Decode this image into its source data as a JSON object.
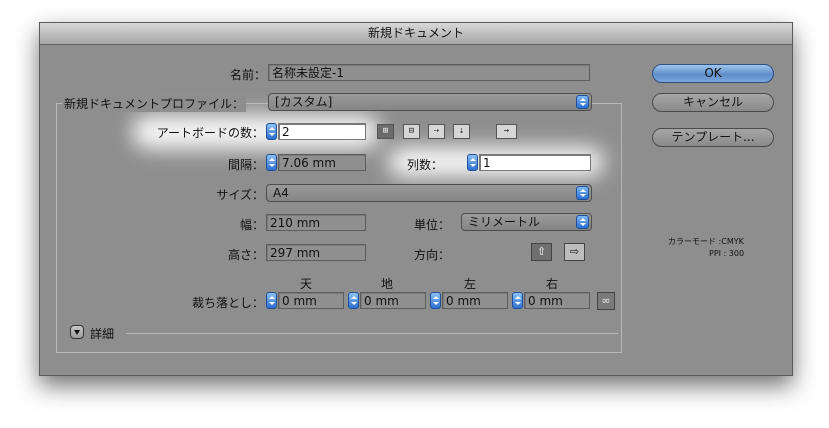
{
  "window": {
    "title": "新規ドキュメント"
  },
  "name": {
    "label": "名前：",
    "value": "名称未設定-1"
  },
  "profile": {
    "label": "新規ドキュメントプロファイル：",
    "value": "[カスタム]"
  },
  "artboards": {
    "label": "アートボードの数：",
    "value": "2",
    "layout_icons": [
      "grid-by-row-icon",
      "grid-by-column-icon",
      "arrange-by-row-icon",
      "arrange-by-column-icon",
      "right-to-left-icon"
    ]
  },
  "spacing": {
    "label": "間隔：",
    "value": "7.06 mm"
  },
  "columns": {
    "label": "列数：",
    "value": "1"
  },
  "size": {
    "label": "サイズ：",
    "value": "A4"
  },
  "width": {
    "label": "幅：",
    "value": "210 mm"
  },
  "units": {
    "label": "単位：",
    "value": "ミリメートル"
  },
  "height": {
    "label": "高さ：",
    "value": "297 mm"
  },
  "orientation": {
    "label": "方向：",
    "selected": "portrait"
  },
  "bleed": {
    "label": "裁ち落とし：",
    "top_label": "天",
    "bottom_label": "地",
    "left_label": "左",
    "right_label": "右",
    "top": "0 mm",
    "bottom": "0 mm",
    "left": "0 mm",
    "right": "0 mm"
  },
  "advanced": {
    "label": "詳細"
  },
  "buttons": {
    "ok": "OK",
    "cancel": "キャンセル",
    "templates": "テンプレート..."
  },
  "info": {
    "color_mode": "カラーモード :CMYK",
    "ppi": "PPI : 300"
  },
  "colors": {
    "accent": "#2e6fd0",
    "dialog_bg": "#8e8e8e"
  }
}
